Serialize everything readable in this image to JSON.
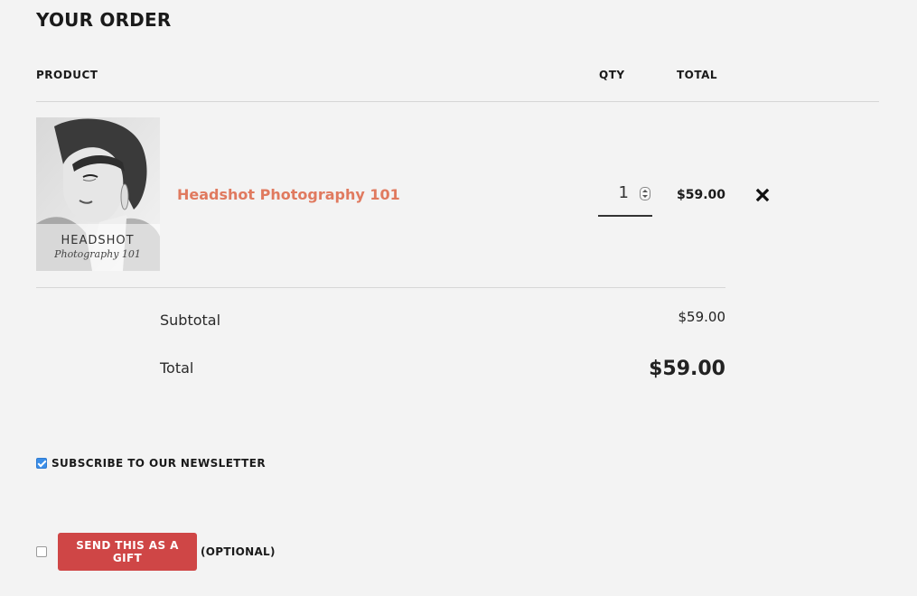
{
  "order": {
    "title": "YOUR ORDER",
    "columns": {
      "product": "PRODUCT",
      "qty": "QTY",
      "total": "TOTAL"
    },
    "items": [
      {
        "name": "Headshot Photography 101",
        "thumbnail_text_line1": "HEADSHOT",
        "thumbnail_text_line2": "Photography 101",
        "qty": "1",
        "total": "$59.00",
        "remove_icon": "close-icon"
      }
    ],
    "summary": {
      "subtotal_label": "Subtotal",
      "subtotal_value": "$59.00",
      "total_label": "Total",
      "total_value": "$59.00"
    }
  },
  "newsletter": {
    "label": "SUBSCRIBE TO OUR NEWSLETTER",
    "checked": true
  },
  "gift": {
    "button_label": "SEND THIS AS A GIFT",
    "optional_label": "(OPTIONAL)",
    "checked": false
  },
  "colors": {
    "background": "#f3f3f3",
    "link": "#e07a5f",
    "gift_button": "#cf4646",
    "checkbox_checked": "#3b8ee8"
  }
}
